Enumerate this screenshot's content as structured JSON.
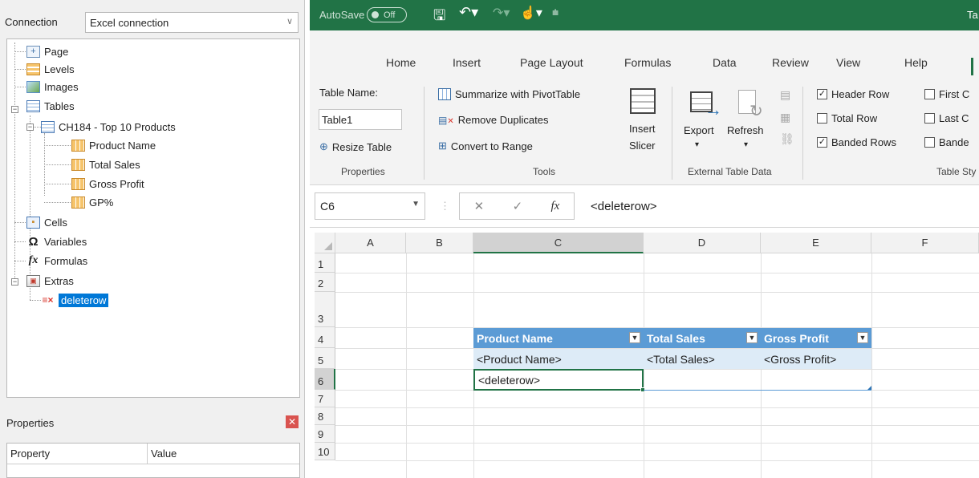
{
  "left_pane": {
    "connection_label": "Connection",
    "connection_value": "Excel connection",
    "tree": {
      "page": "Page",
      "levels": "Levels",
      "images": "Images",
      "tables": "Tables",
      "table_name": "CH184 - Top 10 Products",
      "fields": [
        "Product Name",
        "Total Sales",
        "Gross Profit",
        "GP%"
      ],
      "cells": "Cells",
      "variables": "Variables",
      "formulas": "Formulas",
      "extras": "Extras",
      "deleterow": "deleterow"
    },
    "properties": {
      "title": "Properties",
      "col_property": "Property",
      "col_value": "Value"
    }
  },
  "excel": {
    "titlebar": {
      "autosave": "AutoSave",
      "autosave_state": "Off",
      "doc_title": "Ta"
    },
    "tabs": [
      "Home",
      "Insert",
      "Page Layout",
      "Formulas",
      "Data",
      "Review",
      "View",
      "Help"
    ],
    "ribbon": {
      "table_name_label": "Table Name:",
      "table_name_value": "Table1",
      "resize_table": "Resize Table",
      "group_properties": "Properties",
      "summarize": "Summarize with PivotTable",
      "remove_duplicates": "Remove Duplicates",
      "convert_to_range": "Convert to Range",
      "group_tools": "Tools",
      "insert_slicer_1": "Insert",
      "insert_slicer_2": "Slicer",
      "export": "Export",
      "refresh": "Refresh",
      "group_external": "External Table Data",
      "header_row": "Header Row",
      "total_row": "Total Row",
      "banded_rows": "Banded Rows",
      "first_col": "First C",
      "last_col": "Last C",
      "banded_col": "Bande",
      "group_styles": "Table Sty",
      "header_row_checked": true,
      "total_row_checked": false,
      "banded_rows_checked": true
    },
    "formula_bar": {
      "name_box": "C6",
      "fx": "fx",
      "formula": "<deleterow>"
    },
    "columns": [
      "A",
      "B",
      "C",
      "D",
      "E",
      "F"
    ],
    "rows": [
      "1",
      "2",
      "3",
      "4",
      "5",
      "6",
      "7",
      "8",
      "9",
      "10"
    ],
    "table": {
      "headers": [
        "Product Name",
        "Total Sales",
        "Gross Profit"
      ],
      "row5": [
        "<Product Name>",
        "<Total Sales>",
        "<Gross Profit>"
      ],
      "row6_c": "<deleterow>"
    },
    "colors": {
      "excel_green": "#217346",
      "table_header": "#5b9bd5",
      "table_band": "#ddebf7",
      "selection": "#0078d7"
    }
  }
}
